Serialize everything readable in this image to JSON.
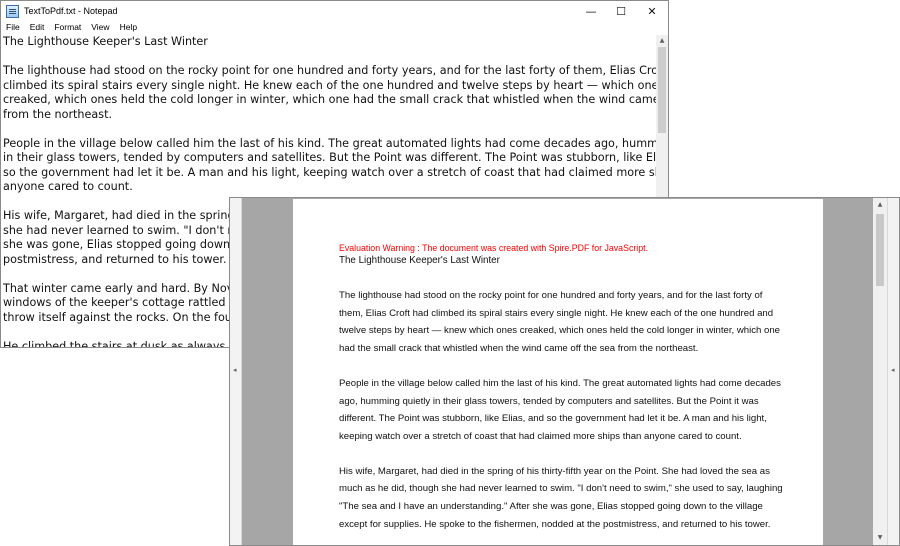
{
  "notepad": {
    "title": "TextToPdf.txt - Notepad",
    "caption": {
      "minimize": "—",
      "maximize": "☐",
      "close": "✕"
    },
    "menu": [
      "File",
      "Edit",
      "Format",
      "View",
      "Help"
    ],
    "lines": [
      "The Lighthouse Keeper's Last Winter",
      "",
      "The lighthouse had stood on the rocky point for one hundred and forty years, and for the last forty of them, Elias Croft had",
      "climbed its spiral stairs every single night. He knew each of the one hundred and twelve steps by heart — which ones",
      "creaked, which ones held the cold longer in winter, which one had the small crack that whistled when the wind came off the sea",
      "from the northeast.",
      "",
      "People in the village below called him the last of his kind. The great automated lights had come decades ago, humming quietly",
      "in their glass towers, tended by computers and satellites. But the Point was different. The Point was stubborn, like Elias, and",
      "so the government had let it be. A man and his light, keeping watch over a stretch of coast that had claimed more ships than",
      "anyone cared to count.",
      "",
      "His wife, Margaret, had died in the spring of",
      "she had never learned to swim. \"I don't need",
      "she was gone, Elias stopped going down to t",
      "postmistress, and returned to his tower.",
      "",
      "That winter came early and hard. By Novemb",
      "windows of the keeper's cottage rattled like t",
      "throw itself against the rocks. On the fourth",
      "",
      "He climbed the stairs at dusk as always. One"
    ]
  },
  "pdf": {
    "warning": "Evaluation Warning : The document was created with Spire.PDF for JavaScript.",
    "title": "The Lighthouse Keeper's Last Winter",
    "paragraphs": [
      [
        "The lighthouse had stood on the rocky point for one hundred and forty years, and for the last forty of",
        "them, Elias Croft had climbed its spiral stairs every single night. He knew each of the one hundred and",
        "twelve steps by heart — knew which ones creaked, which ones held the cold longer in winter, which one",
        "had the small crack that whistled when the wind came off the sea from the northeast."
      ],
      [
        "People in the village below called him the last of his kind. The great automated lights had come decades",
        "ago, humming quietly in their glass towers, tended by computers and satellites. But the Point it was",
        "different. The Point was stubborn, like Elias, and so the government had let it be. A man and his light,",
        "keeping watch over a stretch of coast that had claimed more ships than anyone cared to count."
      ],
      [
        "His wife, Margaret, had died in the spring of his thirty-fifth year on the Point. She had loved the sea as",
        "much as he did, though she had never learned to swim. \"I don't need to swim,\" she used to say, laughing",
        "\"The sea and I have an understanding.\" After she was gone, Elias stopped going down to the village",
        "except for supplies. He spoke to the fishermen, nodded at the postmistress, and returned to his tower."
      ]
    ],
    "icons": {
      "left_collapse": "◂",
      "right_collapse": "◂",
      "scroll_up": "▲",
      "scroll_down": "▼"
    }
  }
}
